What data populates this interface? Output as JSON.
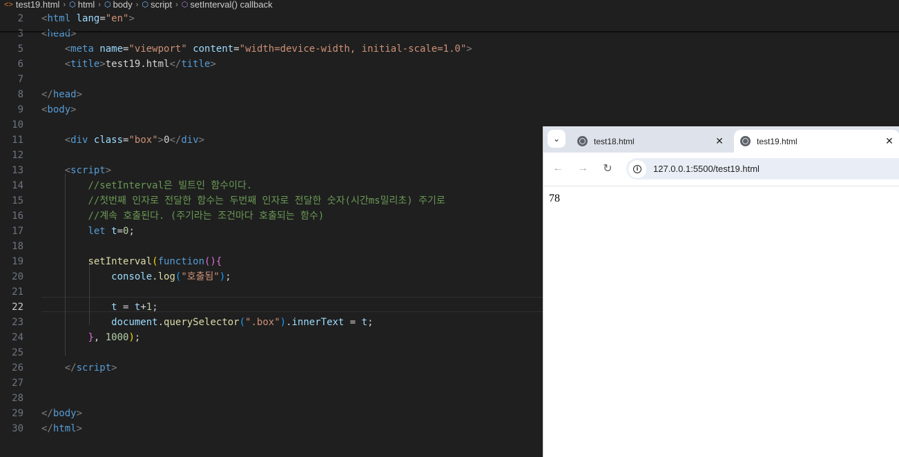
{
  "breadcrumb": {
    "file": "test19.html",
    "items": [
      "html",
      "body",
      "script",
      "setInterval() callback"
    ]
  },
  "editor": {
    "active_line": "22",
    "lines": [
      {
        "n": "2",
        "segs": [
          [
            "t",
            "<"
          ],
          [
            "tag",
            "html"
          ],
          [
            "txt",
            " "
          ],
          [
            "attr",
            "lang"
          ],
          [
            "txt",
            "="
          ],
          [
            "str",
            "\"en\""
          ],
          [
            "t",
            ">"
          ]
        ]
      },
      {
        "n": "3",
        "segs": [
          [
            "t",
            "<"
          ],
          [
            "tag",
            "head"
          ],
          [
            "t",
            ">"
          ]
        ]
      },
      {
        "n": "5",
        "segs": [
          [
            "txt",
            "    "
          ],
          [
            "t",
            "<"
          ],
          [
            "tag",
            "meta"
          ],
          [
            "txt",
            " "
          ],
          [
            "attr",
            "name"
          ],
          [
            "txt",
            "="
          ],
          [
            "str",
            "\"viewport\""
          ],
          [
            "txt",
            " "
          ],
          [
            "attr",
            "content"
          ],
          [
            "txt",
            "="
          ],
          [
            "str",
            "\"width=device-width, initial-scale=1.0\""
          ],
          [
            "t",
            ">"
          ]
        ]
      },
      {
        "n": "6",
        "segs": [
          [
            "txt",
            "    "
          ],
          [
            "t",
            "<"
          ],
          [
            "tag",
            "title"
          ],
          [
            "t",
            ">"
          ],
          [
            "txt",
            "test19.html"
          ],
          [
            "t",
            "</"
          ],
          [
            "tag",
            "title"
          ],
          [
            "t",
            ">"
          ]
        ]
      },
      {
        "n": "7",
        "segs": []
      },
      {
        "n": "8",
        "segs": [
          [
            "t",
            "</"
          ],
          [
            "tag",
            "head"
          ],
          [
            "t",
            ">"
          ]
        ]
      },
      {
        "n": "9",
        "segs": [
          [
            "t",
            "<"
          ],
          [
            "tag",
            "body"
          ],
          [
            "t",
            ">"
          ]
        ]
      },
      {
        "n": "10",
        "segs": []
      },
      {
        "n": "11",
        "segs": [
          [
            "txt",
            "    "
          ],
          [
            "t",
            "<"
          ],
          [
            "tag",
            "div"
          ],
          [
            "txt",
            " "
          ],
          [
            "attr",
            "class"
          ],
          [
            "txt",
            "="
          ],
          [
            "str",
            "\"box\""
          ],
          [
            "t",
            ">"
          ],
          [
            "txt",
            "0"
          ],
          [
            "t",
            "</"
          ],
          [
            "tag",
            "div"
          ],
          [
            "t",
            ">"
          ]
        ]
      },
      {
        "n": "12",
        "segs": []
      },
      {
        "n": "13",
        "segs": [
          [
            "txt",
            "    "
          ],
          [
            "t",
            "<"
          ],
          [
            "tag",
            "script"
          ],
          [
            "t",
            ">"
          ]
        ]
      },
      {
        "n": "14",
        "segs": [
          [
            "txt",
            "        "
          ],
          [
            "cm",
            "//setInterval은 빌트인 함수이다."
          ]
        ]
      },
      {
        "n": "15",
        "segs": [
          [
            "txt",
            "        "
          ],
          [
            "cm",
            "//첫번째 인자로 전달한 함수는 두번째 인자로 전달한 숫자(시간ms밀리초) 주기로"
          ]
        ]
      },
      {
        "n": "16",
        "segs": [
          [
            "txt",
            "        "
          ],
          [
            "cm",
            "//계속 호출된다. (주기라는 조건마다 호출되는 함수)"
          ]
        ]
      },
      {
        "n": "17",
        "segs": [
          [
            "txt",
            "        "
          ],
          [
            "kw",
            "let"
          ],
          [
            "txt",
            " "
          ],
          [
            "var",
            "t"
          ],
          [
            "txt",
            "="
          ],
          [
            "num",
            "0"
          ],
          [
            "txt",
            ";"
          ]
        ]
      },
      {
        "n": "18",
        "segs": []
      },
      {
        "n": "19",
        "segs": [
          [
            "txt",
            "        "
          ],
          [
            "fn",
            "setInterval"
          ],
          [
            "p1",
            "("
          ],
          [
            "kw",
            "function"
          ],
          [
            "p2",
            "()"
          ],
          [
            "p2",
            "{"
          ]
        ]
      },
      {
        "n": "20",
        "segs": [
          [
            "txt",
            "            "
          ],
          [
            "var",
            "console"
          ],
          [
            "txt",
            "."
          ],
          [
            "fn",
            "log"
          ],
          [
            "p3",
            "("
          ],
          [
            "str",
            "\"호출됨\""
          ],
          [
            "p3",
            ")"
          ],
          [
            "txt",
            ";"
          ]
        ]
      },
      {
        "n": "21",
        "segs": []
      },
      {
        "n": "22",
        "segs": [
          [
            "txt",
            "            "
          ],
          [
            "var",
            "t"
          ],
          [
            "txt",
            " = "
          ],
          [
            "var",
            "t"
          ],
          [
            "txt",
            "+"
          ],
          [
            "num",
            "1"
          ],
          [
            "txt",
            ";"
          ]
        ]
      },
      {
        "n": "23",
        "segs": [
          [
            "txt",
            "            "
          ],
          [
            "var",
            "document"
          ],
          [
            "txt",
            "."
          ],
          [
            "fn",
            "querySelector"
          ],
          [
            "p3",
            "("
          ],
          [
            "str",
            "\".box\""
          ],
          [
            "p3",
            ")"
          ],
          [
            "txt",
            "."
          ],
          [
            "var",
            "innerText"
          ],
          [
            "txt",
            " = "
          ],
          [
            "var",
            "t"
          ],
          [
            "txt",
            ";"
          ]
        ]
      },
      {
        "n": "24",
        "segs": [
          [
            "txt",
            "        "
          ],
          [
            "p2",
            "}"
          ],
          [
            "txt",
            ", "
          ],
          [
            "num",
            "1000"
          ],
          [
            "p1",
            ")"
          ],
          [
            "txt",
            ";"
          ]
        ]
      },
      {
        "n": "25",
        "segs": []
      },
      {
        "n": "26",
        "segs": [
          [
            "txt",
            "    "
          ],
          [
            "t",
            "</"
          ],
          [
            "tag",
            "script"
          ],
          [
            "t",
            ">"
          ]
        ]
      },
      {
        "n": "27",
        "segs": []
      },
      {
        "n": "28",
        "segs": []
      },
      {
        "n": "29",
        "segs": [
          [
            "t",
            "</"
          ],
          [
            "tag",
            "body"
          ],
          [
            "t",
            ">"
          ]
        ]
      },
      {
        "n": "30",
        "segs": [
          [
            "t",
            "</"
          ],
          [
            "tag",
            "html"
          ],
          [
            "t",
            ">"
          ]
        ]
      }
    ]
  },
  "browser": {
    "tabs": [
      {
        "title": "test18.html",
        "active": false
      },
      {
        "title": "test19.html",
        "active": true
      }
    ],
    "url": "127.0.0.1:5500/test19.html",
    "page_text": "78"
  },
  "icons": {
    "breadcrumb_file": "html-file-icon",
    "breadcrumb_symbol": "cube-icon",
    "tab_favicon": "globe-icon",
    "back": "arrow-left-icon",
    "forward": "arrow-right-icon",
    "reload": "reload-icon",
    "site_info": "info-icon"
  },
  "colors": {
    "editor_bg": "#1f1f1f",
    "tag": "#569cd6",
    "attribute": "#9cdcfe",
    "string": "#ce9178",
    "comment": "#6a9955",
    "function": "#dcdcaa",
    "number": "#b5cea8"
  }
}
